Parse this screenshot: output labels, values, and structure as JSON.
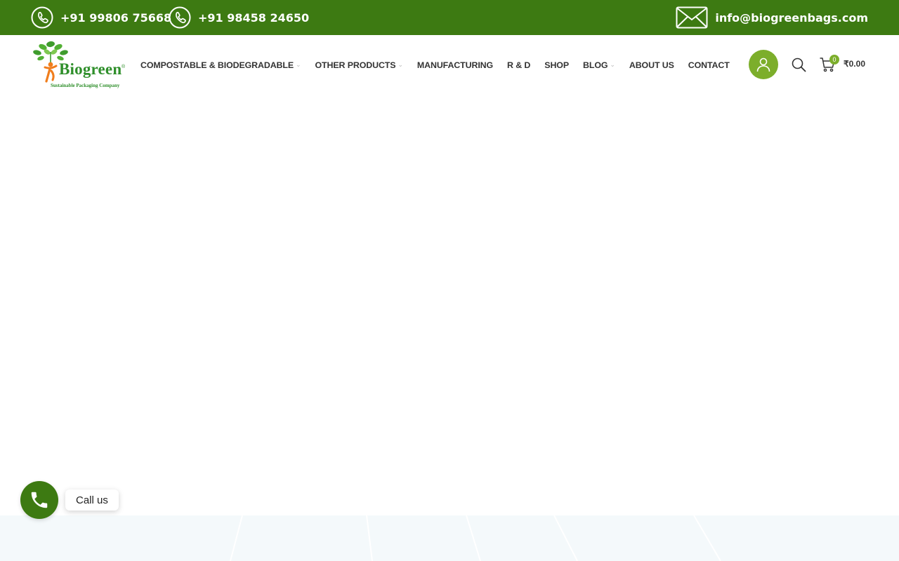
{
  "topbar": {
    "phone1": "+91 99806 75668",
    "phone2": "+91 98458 24650",
    "email": "info@biogreenbags.com",
    "background_color": "#3d7a12",
    "phone_icon": "phone-icon",
    "email_icon": "mail-icon"
  },
  "logo": {
    "name": "Biogreen",
    "registered_mark": "®",
    "tagline": "Sustainable Packaging Company"
  },
  "nav": {
    "items": [
      {
        "label": "COMPOSTABLE & BIODEGRADABLE",
        "has_dropdown": true
      },
      {
        "label": "OTHER PRODUCTS",
        "has_dropdown": true
      },
      {
        "label": "MANUFACTURING",
        "has_dropdown": false
      },
      {
        "label": "R & D",
        "has_dropdown": false
      },
      {
        "label": "SHOP",
        "has_dropdown": false
      },
      {
        "label": "BLOG",
        "has_dropdown": true
      },
      {
        "label": "ABOUT US",
        "has_dropdown": false
      },
      {
        "label": "CONTACT",
        "has_dropdown": false
      }
    ]
  },
  "header_tools": {
    "user_icon": "user-icon",
    "search_icon": "search-icon",
    "cart_icon": "cart-icon",
    "cart_count": "0",
    "cart_total": "₹0.00",
    "accent_color": "#7cae2b"
  },
  "call_widget": {
    "label": "Call us",
    "icon": "phone-icon"
  }
}
